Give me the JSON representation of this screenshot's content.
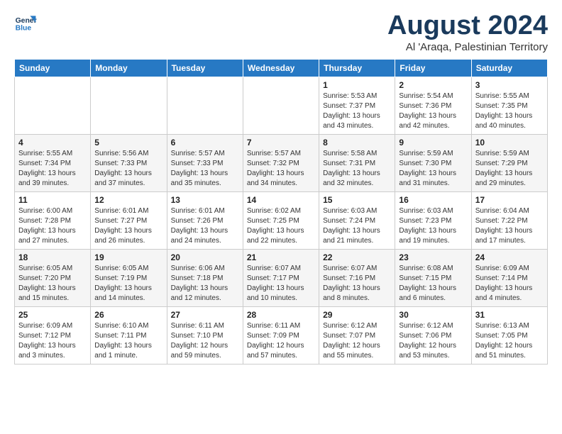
{
  "logo": {
    "line1": "General",
    "line2": "Blue"
  },
  "title": "August 2024",
  "subtitle": "Al 'Araqa, Palestinian Territory",
  "days_of_week": [
    "Sunday",
    "Monday",
    "Tuesday",
    "Wednesday",
    "Thursday",
    "Friday",
    "Saturday"
  ],
  "weeks": [
    [
      {
        "day": "",
        "info": ""
      },
      {
        "day": "",
        "info": ""
      },
      {
        "day": "",
        "info": ""
      },
      {
        "day": "",
        "info": ""
      },
      {
        "day": "1",
        "info": "Sunrise: 5:53 AM\nSunset: 7:37 PM\nDaylight: 13 hours\nand 43 minutes."
      },
      {
        "day": "2",
        "info": "Sunrise: 5:54 AM\nSunset: 7:36 PM\nDaylight: 13 hours\nand 42 minutes."
      },
      {
        "day": "3",
        "info": "Sunrise: 5:55 AM\nSunset: 7:35 PM\nDaylight: 13 hours\nand 40 minutes."
      }
    ],
    [
      {
        "day": "4",
        "info": "Sunrise: 5:55 AM\nSunset: 7:34 PM\nDaylight: 13 hours\nand 39 minutes."
      },
      {
        "day": "5",
        "info": "Sunrise: 5:56 AM\nSunset: 7:33 PM\nDaylight: 13 hours\nand 37 minutes."
      },
      {
        "day": "6",
        "info": "Sunrise: 5:57 AM\nSunset: 7:33 PM\nDaylight: 13 hours\nand 35 minutes."
      },
      {
        "day": "7",
        "info": "Sunrise: 5:57 AM\nSunset: 7:32 PM\nDaylight: 13 hours\nand 34 minutes."
      },
      {
        "day": "8",
        "info": "Sunrise: 5:58 AM\nSunset: 7:31 PM\nDaylight: 13 hours\nand 32 minutes."
      },
      {
        "day": "9",
        "info": "Sunrise: 5:59 AM\nSunset: 7:30 PM\nDaylight: 13 hours\nand 31 minutes."
      },
      {
        "day": "10",
        "info": "Sunrise: 5:59 AM\nSunset: 7:29 PM\nDaylight: 13 hours\nand 29 minutes."
      }
    ],
    [
      {
        "day": "11",
        "info": "Sunrise: 6:00 AM\nSunset: 7:28 PM\nDaylight: 13 hours\nand 27 minutes."
      },
      {
        "day": "12",
        "info": "Sunrise: 6:01 AM\nSunset: 7:27 PM\nDaylight: 13 hours\nand 26 minutes."
      },
      {
        "day": "13",
        "info": "Sunrise: 6:01 AM\nSunset: 7:26 PM\nDaylight: 13 hours\nand 24 minutes."
      },
      {
        "day": "14",
        "info": "Sunrise: 6:02 AM\nSunset: 7:25 PM\nDaylight: 13 hours\nand 22 minutes."
      },
      {
        "day": "15",
        "info": "Sunrise: 6:03 AM\nSunset: 7:24 PM\nDaylight: 13 hours\nand 21 minutes."
      },
      {
        "day": "16",
        "info": "Sunrise: 6:03 AM\nSunset: 7:23 PM\nDaylight: 13 hours\nand 19 minutes."
      },
      {
        "day": "17",
        "info": "Sunrise: 6:04 AM\nSunset: 7:22 PM\nDaylight: 13 hours\nand 17 minutes."
      }
    ],
    [
      {
        "day": "18",
        "info": "Sunrise: 6:05 AM\nSunset: 7:20 PM\nDaylight: 13 hours\nand 15 minutes."
      },
      {
        "day": "19",
        "info": "Sunrise: 6:05 AM\nSunset: 7:19 PM\nDaylight: 13 hours\nand 14 minutes."
      },
      {
        "day": "20",
        "info": "Sunrise: 6:06 AM\nSunset: 7:18 PM\nDaylight: 13 hours\nand 12 minutes."
      },
      {
        "day": "21",
        "info": "Sunrise: 6:07 AM\nSunset: 7:17 PM\nDaylight: 13 hours\nand 10 minutes."
      },
      {
        "day": "22",
        "info": "Sunrise: 6:07 AM\nSunset: 7:16 PM\nDaylight: 13 hours\nand 8 minutes."
      },
      {
        "day": "23",
        "info": "Sunrise: 6:08 AM\nSunset: 7:15 PM\nDaylight: 13 hours\nand 6 minutes."
      },
      {
        "day": "24",
        "info": "Sunrise: 6:09 AM\nSunset: 7:14 PM\nDaylight: 13 hours\nand 4 minutes."
      }
    ],
    [
      {
        "day": "25",
        "info": "Sunrise: 6:09 AM\nSunset: 7:12 PM\nDaylight: 13 hours\nand 3 minutes."
      },
      {
        "day": "26",
        "info": "Sunrise: 6:10 AM\nSunset: 7:11 PM\nDaylight: 13 hours\nand 1 minute."
      },
      {
        "day": "27",
        "info": "Sunrise: 6:11 AM\nSunset: 7:10 PM\nDaylight: 12 hours\nand 59 minutes."
      },
      {
        "day": "28",
        "info": "Sunrise: 6:11 AM\nSunset: 7:09 PM\nDaylight: 12 hours\nand 57 minutes."
      },
      {
        "day": "29",
        "info": "Sunrise: 6:12 AM\nSunset: 7:07 PM\nDaylight: 12 hours\nand 55 minutes."
      },
      {
        "day": "30",
        "info": "Sunrise: 6:12 AM\nSunset: 7:06 PM\nDaylight: 12 hours\nand 53 minutes."
      },
      {
        "day": "31",
        "info": "Sunrise: 6:13 AM\nSunset: 7:05 PM\nDaylight: 12 hours\nand 51 minutes."
      }
    ]
  ]
}
